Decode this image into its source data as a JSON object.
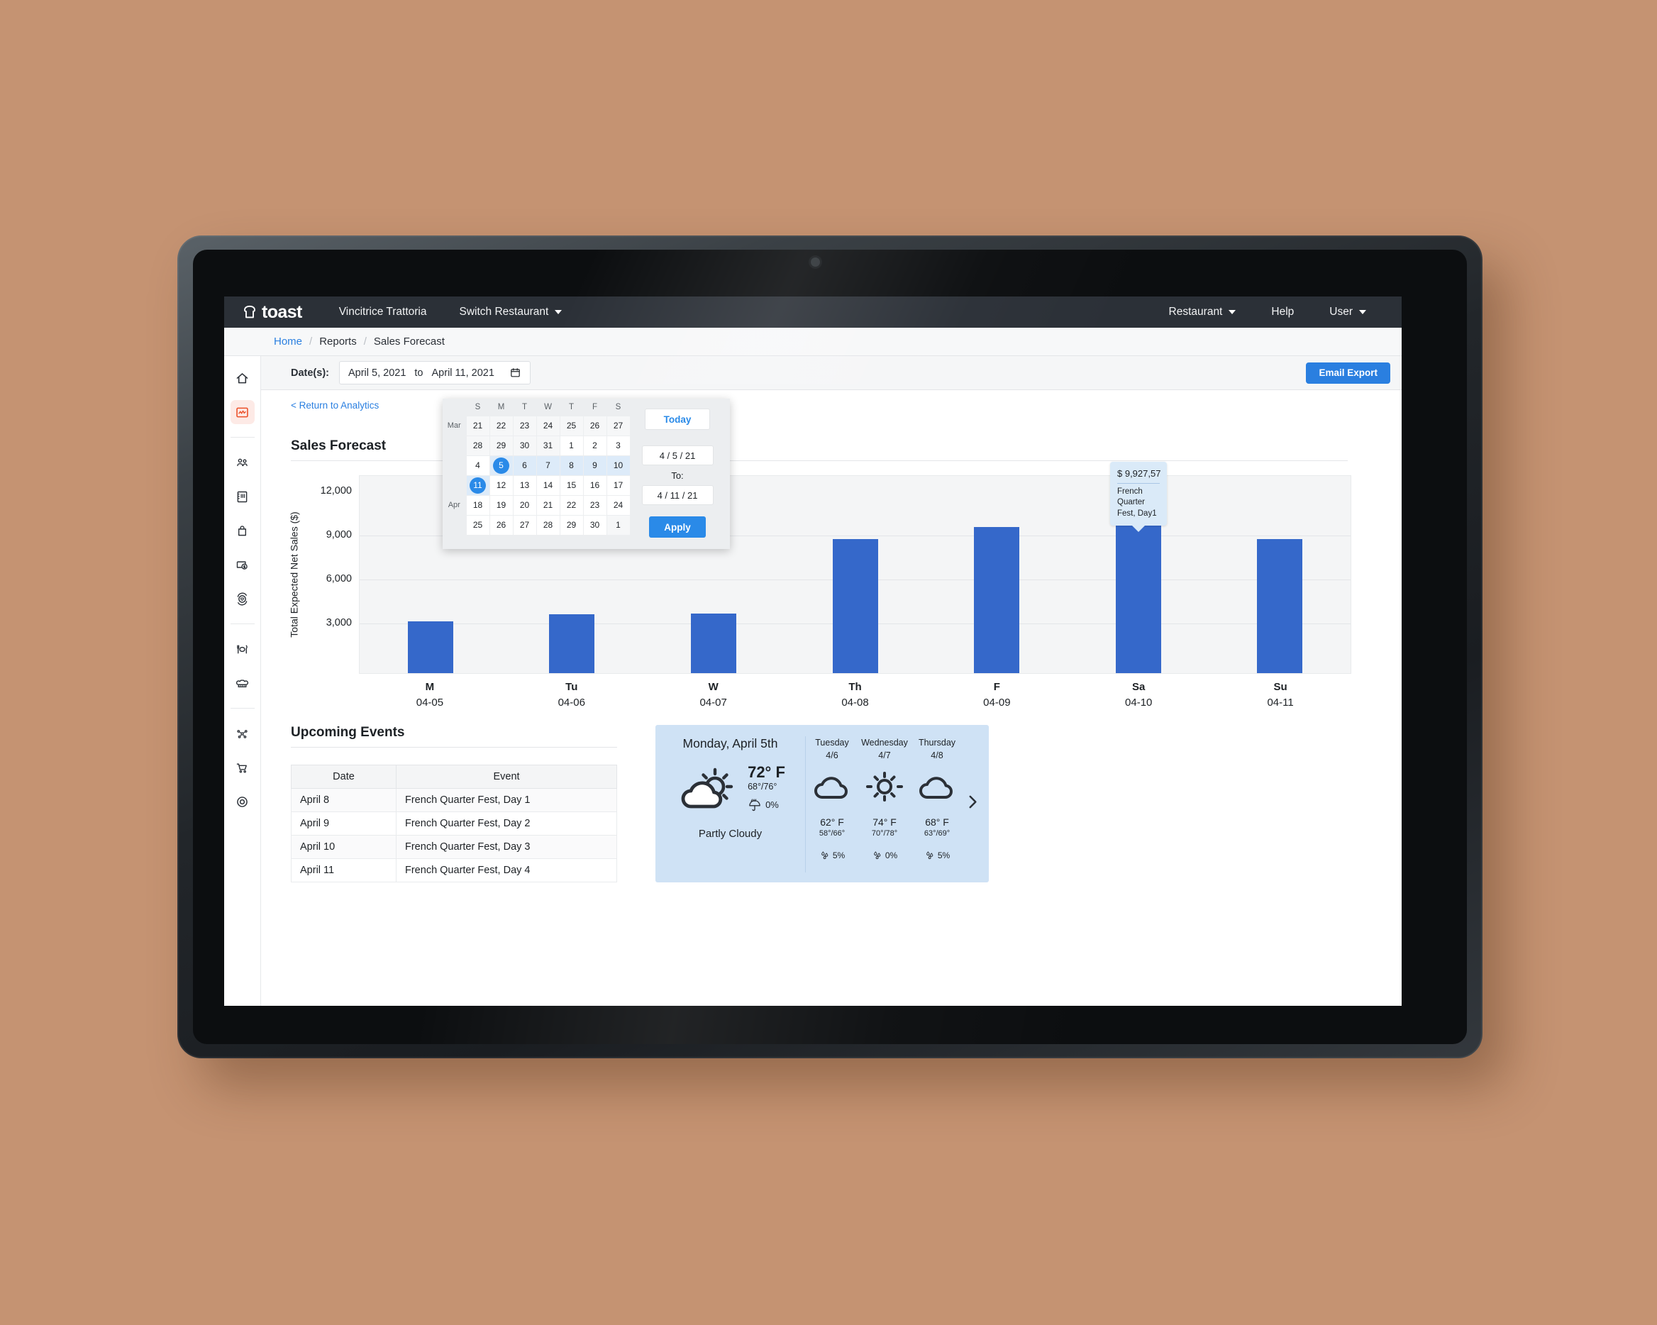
{
  "topnav": {
    "brand": "toast",
    "restaurant_name": "Vincitrice Trattoria",
    "switch_restaurant": "Switch Restaurant",
    "restaurant_menu": "Restaurant",
    "help": "Help",
    "user": "User"
  },
  "breadcrumb": {
    "home": "Home",
    "reports": "Reports",
    "current": "Sales Forecast",
    "sep": "/"
  },
  "sidebar": {
    "items": [
      {
        "name": "home-icon",
        "active": false
      },
      {
        "name": "analytics-icon",
        "active": true
      },
      {
        "name": "guests-icon",
        "active": false
      },
      {
        "name": "menu-book-icon",
        "active": false
      },
      {
        "name": "bag-icon",
        "active": false
      },
      {
        "name": "payments-icon",
        "active": false
      },
      {
        "name": "loyalty-icon",
        "active": false
      },
      {
        "name": "dining-icon",
        "active": false
      },
      {
        "name": "kitchen-icon",
        "active": false
      },
      {
        "name": "integrations-icon",
        "active": false
      },
      {
        "name": "cart-icon",
        "active": false
      },
      {
        "name": "target-icon",
        "active": false
      }
    ]
  },
  "filterbar": {
    "date_label": "Date(s):",
    "date_start": "April 5, 2021",
    "date_join": "to",
    "date_end": "April 11, 2021",
    "email_export": "Email Export"
  },
  "return_link": "< Return to Analytics",
  "section_title": "Sales Forecast",
  "calendar": {
    "weekdays": [
      "S",
      "M",
      "T",
      "W",
      "T",
      "F",
      "S"
    ],
    "month_labels": {
      "mar": "Mar",
      "apr": "Apr"
    },
    "weeks": [
      {
        "month": "Mar",
        "days": [
          {
            "n": "21",
            "state": "other"
          },
          {
            "n": "22",
            "state": "other"
          },
          {
            "n": "23",
            "state": "other"
          },
          {
            "n": "24",
            "state": "other"
          },
          {
            "n": "25",
            "state": "other"
          },
          {
            "n": "26",
            "state": "other"
          },
          {
            "n": "27",
            "state": "other"
          }
        ]
      },
      {
        "month": "",
        "days": [
          {
            "n": "28",
            "state": "other"
          },
          {
            "n": "29",
            "state": "other"
          },
          {
            "n": "30",
            "state": "other"
          },
          {
            "n": "31",
            "state": "other"
          },
          {
            "n": "1",
            "state": "normal"
          },
          {
            "n": "2",
            "state": "normal"
          },
          {
            "n": "3",
            "state": "normal"
          }
        ]
      },
      {
        "month": "",
        "days": [
          {
            "n": "4",
            "state": "normal"
          },
          {
            "n": "5",
            "state": "selected"
          },
          {
            "n": "6",
            "state": "inrange"
          },
          {
            "n": "7",
            "state": "inrange"
          },
          {
            "n": "8",
            "state": "inrange"
          },
          {
            "n": "9",
            "state": "inrange"
          },
          {
            "n": "10",
            "state": "inrange"
          }
        ]
      },
      {
        "month": "",
        "days": [
          {
            "n": "11",
            "state": "selected"
          },
          {
            "n": "12",
            "state": "normal"
          },
          {
            "n": "13",
            "state": "normal"
          },
          {
            "n": "14",
            "state": "normal"
          },
          {
            "n": "15",
            "state": "normal"
          },
          {
            "n": "16",
            "state": "normal"
          },
          {
            "n": "17",
            "state": "normal"
          }
        ]
      },
      {
        "month": "Apr",
        "days": [
          {
            "n": "18",
            "state": "normal"
          },
          {
            "n": "19",
            "state": "normal"
          },
          {
            "n": "20",
            "state": "normal"
          },
          {
            "n": "21",
            "state": "normal"
          },
          {
            "n": "22",
            "state": "normal"
          },
          {
            "n": "23",
            "state": "normal"
          },
          {
            "n": "24",
            "state": "normal"
          }
        ]
      },
      {
        "month": "",
        "days": [
          {
            "n": "25",
            "state": "normal"
          },
          {
            "n": "26",
            "state": "normal"
          },
          {
            "n": "27",
            "state": "normal"
          },
          {
            "n": "28",
            "state": "normal"
          },
          {
            "n": "29",
            "state": "normal"
          },
          {
            "n": "30",
            "state": "normal"
          },
          {
            "n": "1",
            "state": "other"
          }
        ]
      }
    ],
    "today_label": "Today",
    "from_value": "4 / 5 / 21",
    "to_label": "To:",
    "to_value": "4 / 11 / 21",
    "apply_label": "Apply"
  },
  "chart_data": {
    "type": "bar",
    "title": "Sales Forecast",
    "xlabel": "",
    "ylabel": "Total Expected Net Sales ($)",
    "ylim": [
      0,
      13500
    ],
    "yticks": [
      3000,
      6000,
      9000,
      12000
    ],
    "ytick_labels": [
      "3,000",
      "6,000",
      "9,000",
      "12,000"
    ],
    "grid": true,
    "legend": "none",
    "bar_color": "#3568ca",
    "categories": [
      "M\n04-05",
      "Tu\n04-06",
      "W\n04-07",
      "Th\n04-08",
      "F\n04-09",
      "Sa\n04-10",
      "Su\n04-11"
    ],
    "x_day": [
      "M",
      "Tu",
      "W",
      "Th",
      "F",
      "Sa",
      "Su"
    ],
    "x_date": [
      "04-05",
      "04-06",
      "04-07",
      "04-08",
      "04-09",
      "04-10",
      "04-11"
    ],
    "values": [
      3530,
      4020,
      4050,
      9100,
      9928,
      10580,
      9100
    ],
    "annotations": [
      {
        "series_index": 4,
        "value_label": "$ 9,927,57",
        "note": "French Quarter Fest, Day1"
      }
    ]
  },
  "tooltip": {
    "value": "$ 9,927,57",
    "note_line1": "French Quarter",
    "note_line2": "Fest, Day1"
  },
  "events": {
    "title": "Upcoming Events",
    "columns": [
      "Date",
      "Event"
    ],
    "rows": [
      {
        "date": "April 8",
        "event": "French Quarter Fest, Day 1"
      },
      {
        "date": "April 9",
        "event": "French Quarter Fest, Day 2"
      },
      {
        "date": "April 10",
        "event": "French Quarter Fest, Day 3"
      },
      {
        "date": "April 11",
        "event": "French Quarter Fest, Day 4"
      }
    ]
  },
  "weather": {
    "today": {
      "title": "Monday, April 5th",
      "icon": "partly-cloudy-icon",
      "temp": "72° F",
      "range": "68°/76°",
      "precip": "0%",
      "condition": "Partly Cloudy"
    },
    "days": [
      {
        "name": "Tuesday",
        "date": "4/6",
        "icon": "cloudy-icon",
        "temp": "62° F",
        "range": "58°/66°",
        "precip": "5%"
      },
      {
        "name": "Wednesday",
        "date": "4/7",
        "icon": "sunny-icon",
        "temp": "74° F",
        "range": "70°/78°",
        "precip": "0%"
      },
      {
        "name": "Thursday",
        "date": "4/8",
        "icon": "cloudy-icon",
        "temp": "68° F",
        "range": "63°/69°",
        "precip": "5%"
      }
    ]
  },
  "colors": {
    "accent_blue": "#2a7fe0",
    "bar_blue": "#3568ca",
    "toast_orange": "#ec4f28",
    "nav_dark": "#2b3037",
    "weather_bg": "#cfe2f5"
  }
}
